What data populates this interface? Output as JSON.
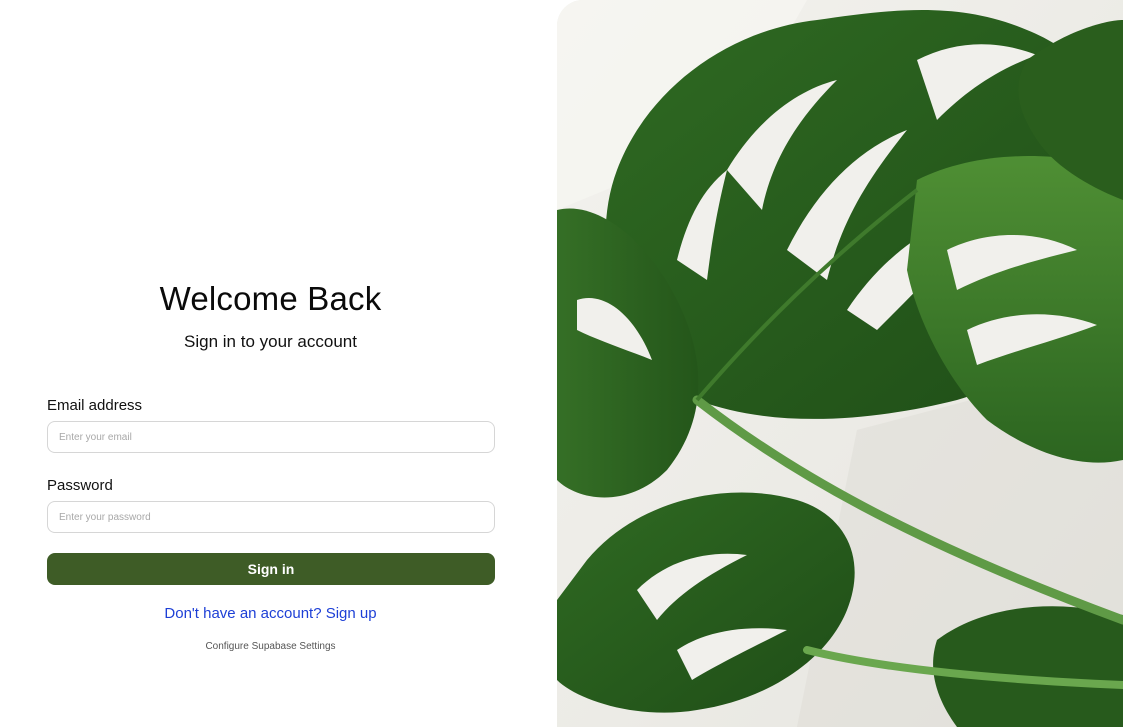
{
  "login": {
    "title": "Welcome Back",
    "subtitle": "Sign in to your account",
    "email": {
      "label": "Email address",
      "placeholder": "Enter your email",
      "value": ""
    },
    "password": {
      "label": "Password",
      "placeholder": "Enter your password",
      "value": ""
    },
    "submit_label": "Sign in",
    "signup_link": "Don't have an account? Sign up",
    "config_link": "Configure Supabase Settings"
  },
  "colors": {
    "accent": "#3e5c26",
    "link": "#1d3fd6",
    "hero_background": "#efeeea",
    "leaf": "#3d7a2c"
  },
  "hero": {
    "icon": "monstera-leaf-photo"
  }
}
